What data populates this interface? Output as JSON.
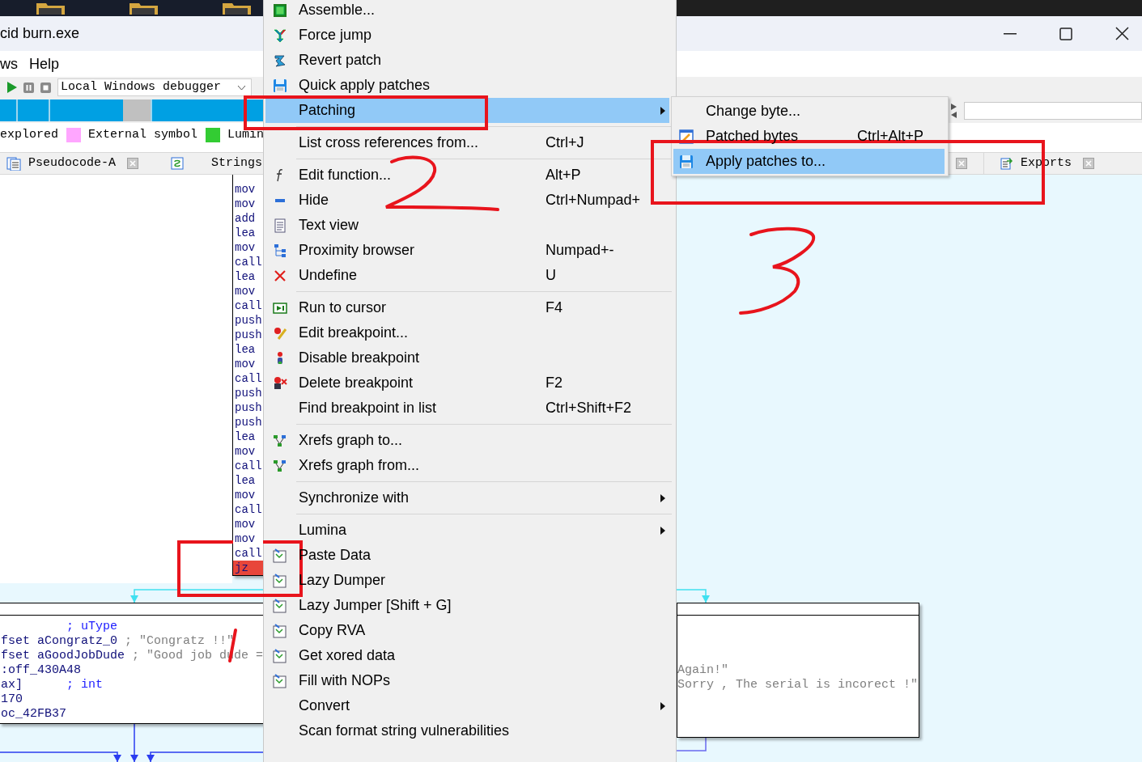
{
  "window": {
    "title": "cid burn.exe"
  },
  "menubar": [
    "ws",
    "Help"
  ],
  "toolbar": {
    "debugger": "Local Windows debugger"
  },
  "legend": [
    {
      "label": "explored"
    },
    {
      "label": "External symbol",
      "color": "#ffa6ff"
    },
    {
      "label": "Lumin",
      "color": "#33cc33"
    }
  ],
  "left_tabs": [
    {
      "label": "Pseudocode-A",
      "kind": "pseudocode",
      "closable": true
    },
    {
      "label": "Strings",
      "kind": "strings",
      "closable": false
    }
  ],
  "right_tabs": [
    {
      "label": "Exports",
      "kind": "exports",
      "closable": true
    }
  ],
  "graph": {
    "instructions": [
      {
        "text": "mov",
        "selected": false
      },
      {
        "text": "mov",
        "selected": false
      },
      {
        "text": "add",
        "selected": false
      },
      {
        "text": "lea",
        "selected": false
      },
      {
        "text": "mov",
        "selected": false
      },
      {
        "text": "call",
        "selected": false
      },
      {
        "text": "lea",
        "selected": false
      },
      {
        "text": "mov",
        "selected": false
      },
      {
        "text": "call",
        "selected": false
      },
      {
        "text": "push",
        "selected": false
      },
      {
        "text": "push",
        "selected": false
      },
      {
        "text": "lea",
        "selected": false
      },
      {
        "text": "mov",
        "selected": false
      },
      {
        "text": "call",
        "selected": false
      },
      {
        "text": "push",
        "selected": false
      },
      {
        "text": "push",
        "selected": false
      },
      {
        "text": "push",
        "selected": false
      },
      {
        "text": "lea",
        "selected": false
      },
      {
        "text": "mov",
        "selected": false
      },
      {
        "text": "call",
        "selected": false
      },
      {
        "text": "lea",
        "selected": false
      },
      {
        "text": "mov",
        "selected": false
      },
      {
        "text": "call",
        "selected": false
      },
      {
        "text": "mov",
        "selected": false
      },
      {
        "text": "mov",
        "selected": false
      },
      {
        "text": "call",
        "selected": false
      },
      {
        "text": "jz",
        "selected": true
      }
    ],
    "left_node": [
      {
        "comment": "; uType",
        "color": "#2020ff"
      },
      {
        "code": "fset aCongratz_0",
        "comment": "; \"Congratz !!\"",
        "color": "#808080"
      },
      {
        "code": "fset aGoodJobDude",
        "comment": "; \"Good job dude =",
        "color": "#808080"
      },
      {
        "code": ":off_430A48"
      },
      {
        "code": "ax]",
        "comment": "; int",
        "color": "#2020ff"
      },
      {
        "code": "170"
      },
      {
        "code": "oc_42FB37"
      }
    ],
    "right_node": [
      "Again!\"",
      "Sorry , The serial is incorect !\""
    ]
  },
  "context_menu": {
    "groups": [
      [
        {
          "label": "Assemble...",
          "kind": "chip",
          "submenu": false,
          "selected": false
        },
        {
          "label": "Force jump",
          "kind": "fork",
          "submenu": false,
          "selected": false
        },
        {
          "label": "Revert patch",
          "kind": "revert",
          "submenu": false,
          "selected": false
        },
        {
          "label": "Quick apply patches",
          "kind": "save",
          "submenu": false,
          "selected": false
        },
        {
          "label": "Patching",
          "kind": "plain",
          "submenu": true,
          "selected": true
        }
      ],
      [
        {
          "label": "List cross references from...",
          "shortcut": "Ctrl+J",
          "kind": "plain",
          "submenu": false,
          "selected": false
        }
      ],
      [
        {
          "label": "Edit function...",
          "shortcut": "Alt+P",
          "kind": "function",
          "submenu": false,
          "selected": false
        },
        {
          "label": "Hide",
          "shortcut": "Ctrl+Numpad+",
          "kind": "hide",
          "submenu": false,
          "selected": false
        },
        {
          "label": "Text view",
          "kind": "text",
          "submenu": false,
          "selected": false
        },
        {
          "label": "Proximity browser",
          "shortcut": "Numpad+-",
          "kind": "tree",
          "submenu": false,
          "selected": false
        },
        {
          "label": "Undefine",
          "shortcut": "U",
          "kind": "undefine",
          "submenu": false,
          "selected": false
        }
      ],
      [
        {
          "label": "Run to cursor",
          "shortcut": "F4",
          "kind": "run",
          "submenu": false,
          "selected": false
        },
        {
          "label": "Edit breakpoint...",
          "kind": "bp-edit",
          "submenu": false,
          "selected": false
        },
        {
          "label": "Disable breakpoint",
          "kind": "bp-disable",
          "submenu": false,
          "selected": false
        },
        {
          "label": "Delete breakpoint",
          "shortcut": "F2",
          "kind": "bp-delete",
          "submenu": false,
          "selected": false
        },
        {
          "label": "Find breakpoint in list",
          "shortcut": "Ctrl+Shift+F2",
          "kind": "plain",
          "submenu": false,
          "selected": false
        }
      ],
      [
        {
          "label": "Xrefs graph to...",
          "kind": "graph",
          "submenu": false,
          "selected": false
        },
        {
          "label": "Xrefs graph from...",
          "kind": "graph",
          "submenu": false,
          "selected": false
        }
      ],
      [
        {
          "label": "Synchronize with",
          "kind": "plain",
          "submenu": true,
          "selected": false
        }
      ],
      [
        {
          "label": "Lumina",
          "kind": "plain",
          "submenu": true,
          "selected": false
        },
        {
          "label": "Paste Data",
          "kind": "plugin",
          "submenu": false,
          "selected": false
        },
        {
          "label": "Lazy Dumper",
          "kind": "plugin",
          "submenu": false,
          "selected": false
        },
        {
          "label": "Lazy Jumper [Shift + G]",
          "kind": "plugin",
          "submenu": false,
          "selected": false
        },
        {
          "label": "Copy RVA",
          "kind": "plugin",
          "submenu": false,
          "selected": false
        },
        {
          "label": "Get xored data",
          "kind": "plugin",
          "submenu": false,
          "selected": false
        },
        {
          "label": "Fill with NOPs",
          "kind": "plugin",
          "submenu": false,
          "selected": false
        },
        {
          "label": "Convert",
          "kind": "plain",
          "submenu": true,
          "selected": false
        },
        {
          "label": "Scan format string vulnerabilities",
          "kind": "plain",
          "submenu": false,
          "selected": false
        }
      ]
    ]
  },
  "submenu": [
    {
      "label": "Change byte...",
      "kind": "plain",
      "selected": false
    },
    {
      "label": "Patched bytes",
      "shortcut": "Ctrl+Alt+P",
      "kind": "edit",
      "selected": false
    },
    {
      "label": "Apply patches to...",
      "kind": "save",
      "selected": true
    }
  ]
}
